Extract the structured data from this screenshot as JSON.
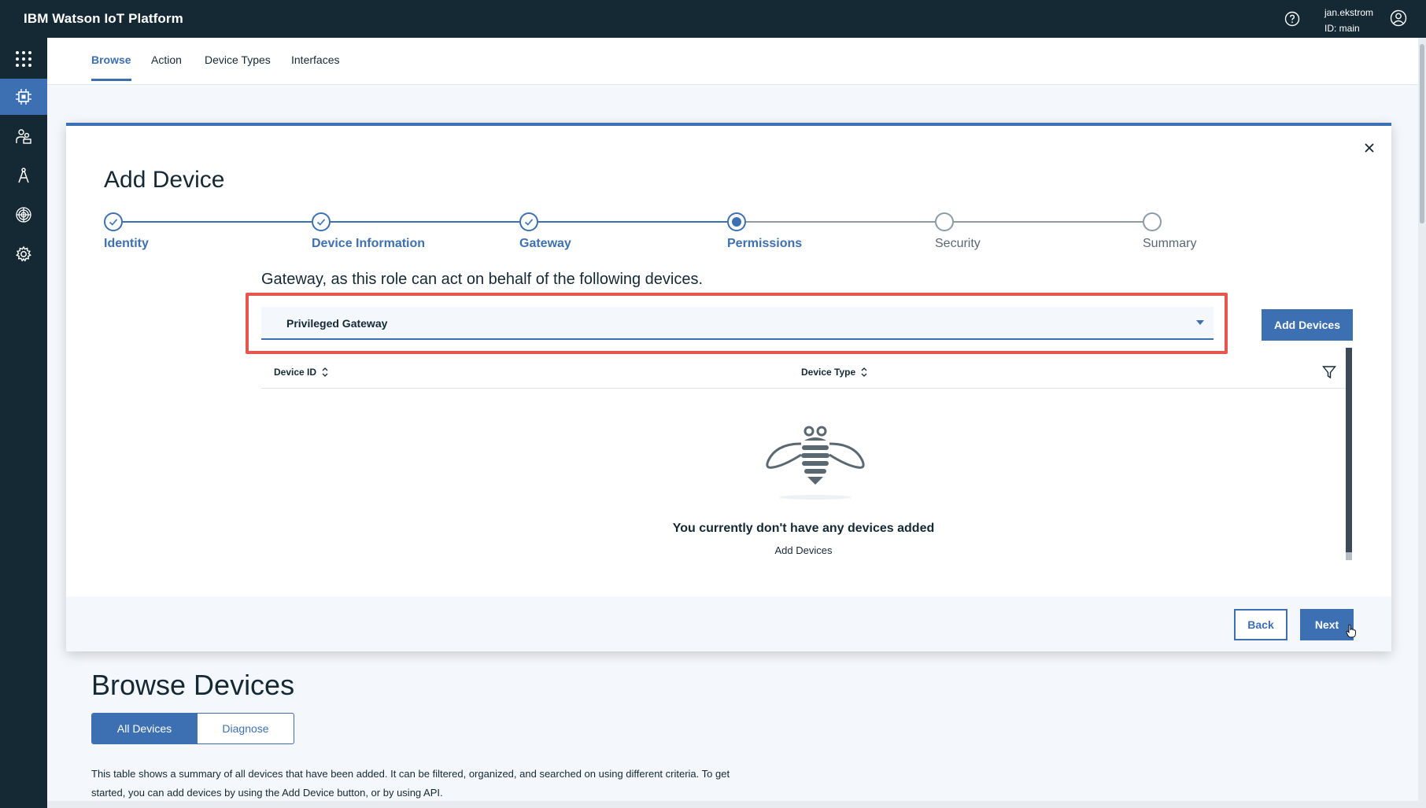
{
  "header": {
    "app_title": "IBM Watson IoT Platform",
    "user_name": "jan.ekstrom",
    "user_id": "ID: main"
  },
  "rail": {
    "items": [
      {
        "icon": "apps-grid-icon",
        "active": false
      },
      {
        "icon": "chip-icon",
        "active": true
      },
      {
        "icon": "members-icon",
        "active": false
      },
      {
        "icon": "compass-icon",
        "active": false
      },
      {
        "icon": "security-icon",
        "active": false
      },
      {
        "icon": "settings-gear-icon",
        "active": false
      }
    ]
  },
  "tabs": [
    {
      "label": "Browse",
      "active": true
    },
    {
      "label": "Action",
      "active": false
    },
    {
      "label": "Device Types",
      "active": false
    },
    {
      "label": "Interfaces",
      "active": false
    }
  ],
  "modal": {
    "title": "Add Device",
    "steps": [
      {
        "label": "Identity",
        "state": "done"
      },
      {
        "label": "Device Information",
        "state": "done"
      },
      {
        "label": "Gateway",
        "state": "done"
      },
      {
        "label": "Permissions",
        "state": "current"
      },
      {
        "label": "Security",
        "state": "pending"
      },
      {
        "label": "Summary",
        "state": "pending"
      }
    ],
    "instruction": "Gateway, as this role can act on behalf of the following devices.",
    "role_select": {
      "value": "Privileged Gateway"
    },
    "add_devices_button": "Add Devices",
    "table": {
      "columns": [
        "Device ID",
        "Device Type"
      ]
    },
    "empty_state": {
      "message": "You currently don't have any devices added",
      "link": "Add Devices"
    },
    "back_button": "Back",
    "next_button": "Next"
  },
  "browse": {
    "title": "Browse Devices",
    "segments": [
      {
        "label": "All Devices",
        "active": true
      },
      {
        "label": "Diagnose",
        "active": false
      }
    ],
    "description": "This table shows a summary of all devices that have been added. It can be filtered, organized, and searched on using different criteria. To get started, you can add devices by using the Add Device button, or by using API."
  },
  "colors": {
    "header_bg": "#152935",
    "accent": "#3d70b2",
    "highlight": "#e8574f"
  }
}
